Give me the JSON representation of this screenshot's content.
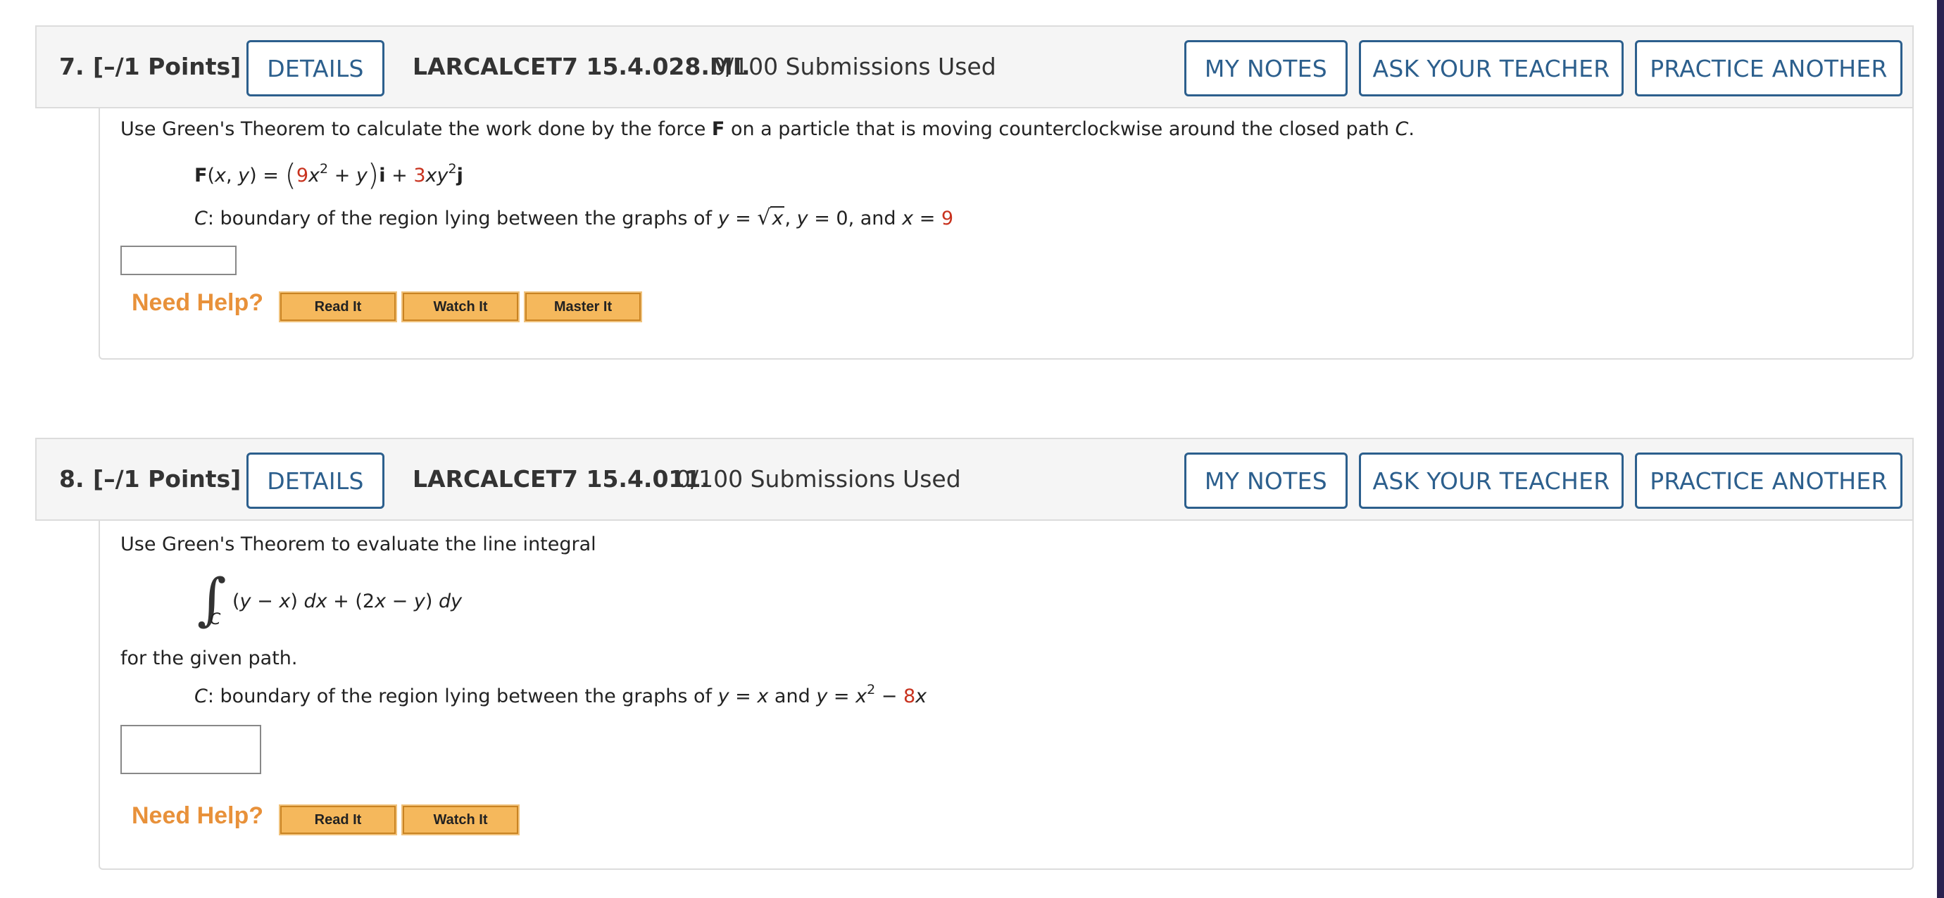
{
  "colors": {
    "accent": "#2c5f8d",
    "help": "#e8913a",
    "value_red": "#c8321e",
    "help_button": "#f5b85c"
  },
  "question7": {
    "number": "7.",
    "points": "[–/1 Points]",
    "details_label": "DETAILS",
    "code": "LARCALCET7 15.4.028.MI.",
    "submissions": "0/100 Submissions Used",
    "my_notes_label": "MY NOTES",
    "ask_teacher_label": "ASK YOUR TEACHER",
    "practice_label": "PRACTICE ANOTHER",
    "prompt_a": "Use Green's Theorem to calculate the work done by the force ",
    "prompt_bold": "F",
    "prompt_b": " on a particle that is moving counterclockwise around the closed path ",
    "prompt_c": "C",
    "prompt_d": ".",
    "force": {
      "F": "F",
      "args_open": "(",
      "x": "x",
      "comma": ", ",
      "y": "y",
      "args_close": ") = ",
      "paren_open": "(",
      "coef1": "9",
      "x2": "x",
      "exp1": "2",
      "plus_y": " + ",
      "y2": "y",
      "paren_close": ")",
      "i": "i",
      "plus": " + ",
      "coef2": "3",
      "xy": "xy",
      "exp2": "2",
      "j": "j"
    },
    "path": {
      "C": "C",
      "text1": ": boundary of the region lying between the graphs of ",
      "y1": "y",
      "eq1": " = ",
      "rad": "√",
      "radicand": "x",
      "comma": ", ",
      "y2": "y",
      "eq2": " = 0, and ",
      "x": "x",
      "eq3": " = ",
      "value": "9"
    },
    "need_help": "Need Help?",
    "help_buttons": [
      "Read It",
      "Watch It",
      "Master It"
    ]
  },
  "question8": {
    "number": "8.",
    "points": "[–/1 Points]",
    "details_label": "DETAILS",
    "code": "LARCALCET7 15.4.011.",
    "submissions": "0/100 Submissions Used",
    "my_notes_label": "MY NOTES",
    "ask_teacher_label": "ASK YOUR TEACHER",
    "practice_label": "PRACTICE ANOTHER",
    "prompt": "Use Green's Theorem to evaluate the line integral",
    "integral": {
      "sign": "∫",
      "sub": "C",
      "expr_a": "(",
      "y1": "y",
      "minus1": " − ",
      "x1": "x",
      "expr_b": ") ",
      "dx": "dx",
      "expr_c": " + (2",
      "x2": "x",
      "minus2": " − ",
      "y2": "y",
      "expr_d": ") ",
      "dy": "dy"
    },
    "for_path": "for the given path.",
    "path": {
      "C": "C",
      "text1": ": boundary of the region lying between the graphs of ",
      "y1": "y",
      "eq1": " = ",
      "x1": "x",
      "and": " and ",
      "y2": "y",
      "eq2": " = ",
      "x2": "x",
      "exp": "2",
      "minus": " − ",
      "value": "8",
      "x3": "x"
    },
    "need_help": "Need Help?",
    "help_buttons": [
      "Read It",
      "Watch It"
    ]
  }
}
